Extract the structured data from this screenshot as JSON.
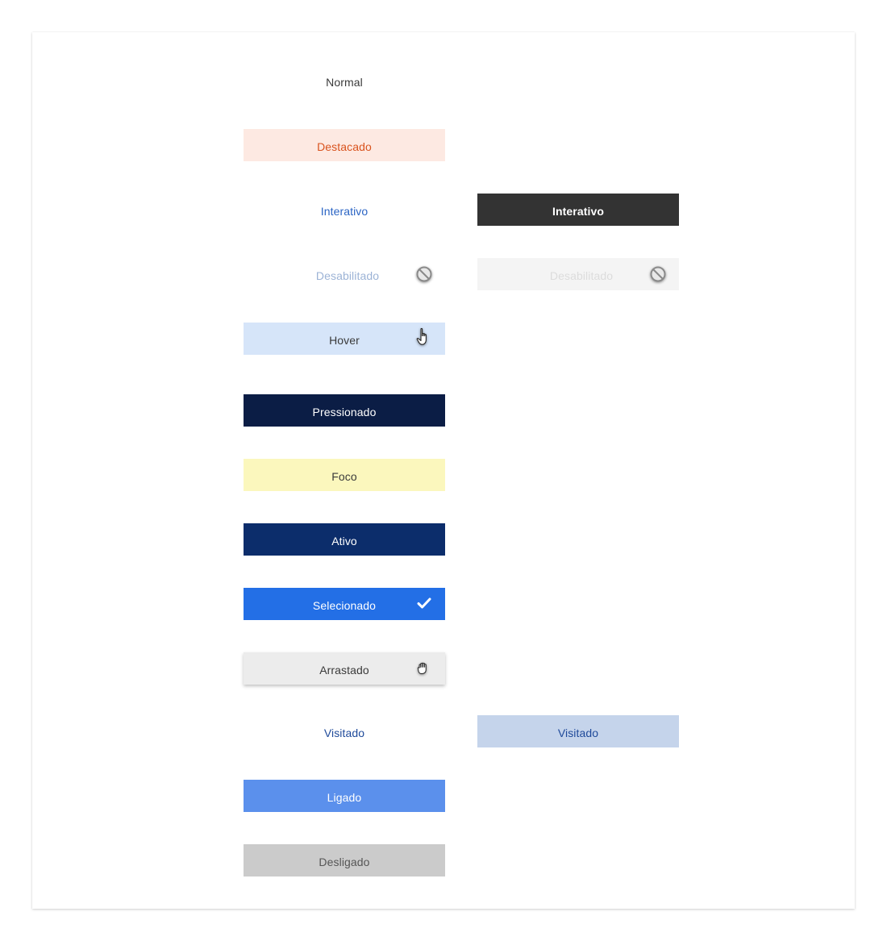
{
  "states": {
    "normal": "Normal",
    "destacado": "Destacado",
    "interativo": "Interativo",
    "interativo_dark": "Interativo",
    "desabilitado": "Desabilitado",
    "desabilitado_bg": "Desabilitado",
    "hover": "Hover",
    "pressionado": "Pressionado",
    "foco": "Foco",
    "ativo": "Ativo",
    "selecionado": "Selecionado",
    "arrastado": "Arrastado",
    "visitado": "Visitado",
    "visitado_bg": "Visitado",
    "ligado": "Ligado",
    "desligado": "Desligado"
  },
  "icons": {
    "disabled": "not-allowed-icon",
    "hover": "pointer-hand-icon",
    "selected": "checkmark-icon",
    "drag": "grab-hand-icon"
  },
  "colors": {
    "destacado_bg": "#fde9e2",
    "destacado_text": "#d9531e",
    "interativo_text": "#2a64c4",
    "interativo_dark_bg": "#333333",
    "hover_bg": "#d6e5f9",
    "pressionado_bg": "#0b1d45",
    "foco_bg": "#fbf7bd",
    "ativo_bg": "#0c2d6b",
    "selecionado_bg": "#236fe6",
    "arrastado_bg": "#ececec",
    "visitado_bg": "#c5d4eb",
    "ligado_bg": "#5b90ec",
    "desligado_bg": "#cbcbcb"
  }
}
